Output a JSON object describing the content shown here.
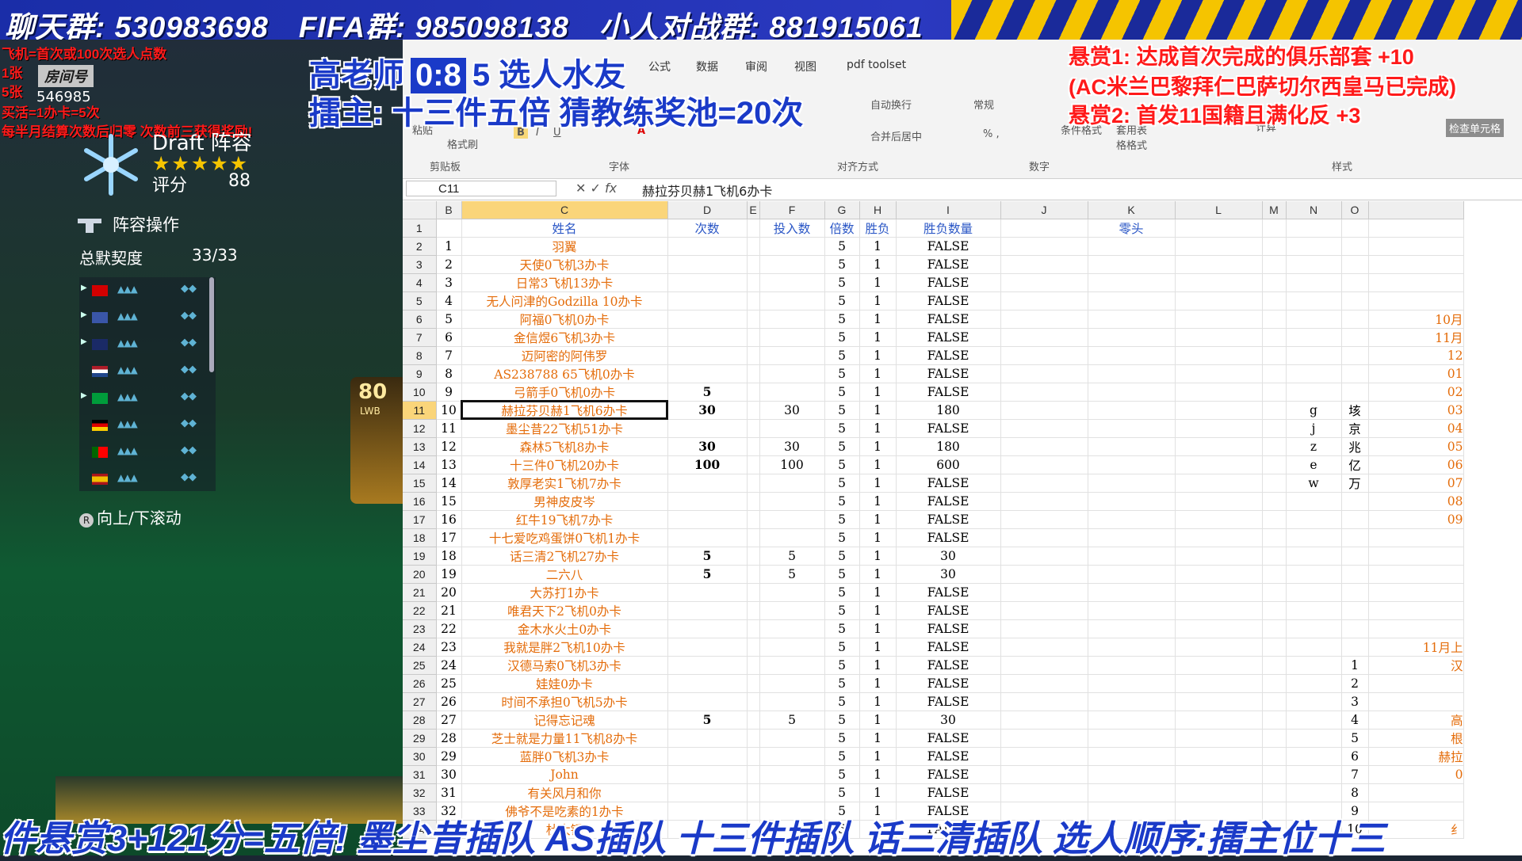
{
  "banner": {
    "chat_group": "聊天群: 530983698",
    "fifa_group": "FIFA群: 985098138",
    "battle_group": "小人对战群: 881915061"
  },
  "stream_notes": {
    "line1": "飞机=首次或100次选人点数",
    "line2": "1张",
    "line3": "5张",
    "line4": "买活=1办卡=5次",
    "line5": "每半月结算次数后归零 次数前三获得奖励!"
  },
  "room": {
    "label": "房间号",
    "number": "546985"
  },
  "draft": {
    "title": "Draft 阵容",
    "stars": "★★★★★",
    "rating_label": "评分",
    "rating_value": "88",
    "lineup_ops": "阵容操作",
    "chemistry_label": "总默契度",
    "chemistry_value": "33/33",
    "scroll_hint": "向上/下滚动",
    "player_rating": "80",
    "player_position": "LWB"
  },
  "overlay": {
    "teacher_prefix": "高老师",
    "score": "0:8",
    "teacher_suffix": "5 选人水友",
    "host_line": "擂主: 十三件五倍 猜教练奖池=20次",
    "reward1": "悬赏1: 达成首次完成的俱乐部套 +10",
    "reward1_note": "(AC米兰巴黎拜仁巴萨切尔西皇马已完成)",
    "reward2": "悬赏2: 首发11国籍且满化反 +3",
    "ticker": "件悬赏3+121分=五倍! 墨尘昔插队 AS插队 十三件插队 话三清插队 选人顺序:擂主位十三"
  },
  "excel": {
    "tabs": [
      "公式",
      "数据",
      "审阅",
      "视图",
      "pdf toolset"
    ],
    "groups": [
      "剪贴板",
      "字体",
      "对齐方式",
      "数字",
      "样式"
    ],
    "buttons": {
      "format_painter": "格式刷",
      "paste": "粘贴",
      "wrap_text": "自动换行",
      "merge_center": "合并后居中",
      "number_format": "常规",
      "conditional_format": "条件格式",
      "table_format": "套用表格格式",
      "calc": "计算",
      "check_cell": "检查单元格"
    },
    "name_box": "C11",
    "formula": "赫拉芬贝赫1飞机6办卡",
    "columns": [
      "B",
      "C",
      "D",
      "E",
      "F",
      "G",
      "H",
      "I",
      "J",
      "K",
      "L",
      "M",
      "N",
      "O",
      ""
    ],
    "header_row": {
      "c": "姓名",
      "d": "次数",
      "f": "投入数",
      "g": "倍数",
      "h": "胜负",
      "i": "胜负数量",
      "k": "零头"
    },
    "rows": [
      {
        "r": "2",
        "b": "1",
        "c": "羽翼",
        "d": "",
        "f": "",
        "g": "5",
        "h": "1",
        "i": "FALSE",
        "n": "",
        "o": "",
        "p": ""
      },
      {
        "r": "3",
        "b": "2",
        "c": "天使0飞机3办卡",
        "d": "",
        "f": "",
        "g": "5",
        "h": "1",
        "i": "FALSE",
        "n": "",
        "o": "",
        "p": ""
      },
      {
        "r": "4",
        "b": "3",
        "c": "日常3飞机13办卡",
        "d": "",
        "f": "",
        "g": "5",
        "h": "1",
        "i": "FALSE",
        "n": "",
        "o": "",
        "p": ""
      },
      {
        "r": "5",
        "b": "4",
        "c": "无人问津的Godzilla 10办卡",
        "d": "",
        "f": "",
        "g": "5",
        "h": "1",
        "i": "FALSE",
        "n": "",
        "o": "",
        "p": ""
      },
      {
        "r": "6",
        "b": "5",
        "c": "阿福0飞机0办卡",
        "d": "",
        "f": "",
        "g": "5",
        "h": "1",
        "i": "FALSE",
        "n": "",
        "o": "",
        "p": "10月"
      },
      {
        "r": "7",
        "b": "6",
        "c": "金信煜6飞机3办卡",
        "d": "",
        "f": "",
        "g": "5",
        "h": "1",
        "i": "FALSE",
        "n": "",
        "o": "",
        "p": "11月"
      },
      {
        "r": "8",
        "b": "7",
        "c": "迈阿密的阿伟罗",
        "d": "",
        "f": "",
        "g": "5",
        "h": "1",
        "i": "FALSE",
        "n": "",
        "o": "",
        "p": "12"
      },
      {
        "r": "9",
        "b": "8",
        "c": "AS238788 65飞机0办卡",
        "d": "",
        "f": "",
        "g": "5",
        "h": "1",
        "i": "FALSE",
        "n": "",
        "o": "",
        "p": "01"
      },
      {
        "r": "10",
        "b": "9",
        "c": "弓箭手0飞机0办卡",
        "d": "5",
        "f": "",
        "g": "5",
        "h": "1",
        "i": "FALSE",
        "n": "",
        "o": "",
        "p": "02"
      },
      {
        "r": "11",
        "b": "10",
        "c": "赫拉芬贝赫1飞机6办卡",
        "d": "30",
        "f": "30",
        "g": "5",
        "h": "1",
        "i": "180",
        "n": "g",
        "o": "垓",
        "p": "03"
      },
      {
        "r": "12",
        "b": "11",
        "c": "墨尘昔22飞机51办卡",
        "d": "",
        "f": "",
        "g": "5",
        "h": "1",
        "i": "FALSE",
        "n": "j",
        "o": "京",
        "p": "04"
      },
      {
        "r": "13",
        "b": "12",
        "c": "森林5飞机8办卡",
        "d": "30",
        "f": "30",
        "g": "5",
        "h": "1",
        "i": "180",
        "n": "z",
        "o": "兆",
        "p": "05"
      },
      {
        "r": "14",
        "b": "13",
        "c": "十三件0飞机20办卡",
        "d": "100",
        "f": "100",
        "g": "5",
        "h": "1",
        "i": "600",
        "n": "e",
        "o": "亿",
        "p": "06"
      },
      {
        "r": "15",
        "b": "14",
        "c": "敦厚老实1飞机7办卡",
        "d": "",
        "f": "",
        "g": "5",
        "h": "1",
        "i": "FALSE",
        "n": "w",
        "o": "万",
        "p": "07"
      },
      {
        "r": "16",
        "b": "15",
        "c": "男神皮皮岑",
        "d": "",
        "f": "",
        "g": "5",
        "h": "1",
        "i": "FALSE",
        "n": "",
        "o": "",
        "p": "08"
      },
      {
        "r": "17",
        "b": "16",
        "c": "红牛19飞机7办卡",
        "d": "",
        "f": "",
        "g": "5",
        "h": "1",
        "i": "FALSE",
        "n": "",
        "o": "",
        "p": "09"
      },
      {
        "r": "18",
        "b": "17",
        "c": "十七爱吃鸡蛋饼0飞机1办卡",
        "d": "",
        "f": "",
        "g": "5",
        "h": "1",
        "i": "FALSE",
        "n": "",
        "o": "",
        "p": ""
      },
      {
        "r": "19",
        "b": "18",
        "c": "话三清2飞机27办卡",
        "d": "5",
        "f": "5",
        "g": "5",
        "h": "1",
        "i": "30",
        "n": "",
        "o": "",
        "p": ""
      },
      {
        "r": "20",
        "b": "19",
        "c": "二六八",
        "d": "5",
        "f": "5",
        "g": "5",
        "h": "1",
        "i": "30",
        "n": "",
        "o": "",
        "p": ""
      },
      {
        "r": "21",
        "b": "20",
        "c": "大苏打1办卡",
        "d": "",
        "f": "",
        "g": "5",
        "h": "1",
        "i": "FALSE",
        "n": "",
        "o": "",
        "p": ""
      },
      {
        "r": "22",
        "b": "21",
        "c": "唯君天下2飞机0办卡",
        "d": "",
        "f": "",
        "g": "5",
        "h": "1",
        "i": "FALSE",
        "n": "",
        "o": "",
        "p": ""
      },
      {
        "r": "23",
        "b": "22",
        "c": "金木水火土0办卡",
        "d": "",
        "f": "",
        "g": "5",
        "h": "1",
        "i": "FALSE",
        "n": "",
        "o": "",
        "p": ""
      },
      {
        "r": "24",
        "b": "23",
        "c": "我就是胖2飞机10办卡",
        "d": "",
        "f": "",
        "g": "5",
        "h": "1",
        "i": "FALSE",
        "n": "",
        "o": "",
        "p": "11月上"
      },
      {
        "r": "25",
        "b": "24",
        "c": "汉德马索0飞机3办卡",
        "d": "",
        "f": "",
        "g": "5",
        "h": "1",
        "i": "FALSE",
        "n": "",
        "o": "1",
        "p": "汉"
      },
      {
        "r": "26",
        "b": "25",
        "c": "娃娃0办卡",
        "d": "",
        "f": "",
        "g": "5",
        "h": "1",
        "i": "FALSE",
        "n": "",
        "o": "2",
        "p": ""
      },
      {
        "r": "27",
        "b": "26",
        "c": "时间不承担0飞机5办卡",
        "d": "",
        "f": "",
        "g": "5",
        "h": "1",
        "i": "FALSE",
        "n": "",
        "o": "3",
        "p": ""
      },
      {
        "r": "28",
        "b": "27",
        "c": "记得忘记魂",
        "d": "5",
        "f": "5",
        "g": "5",
        "h": "1",
        "i": "30",
        "n": "",
        "o": "4",
        "p": "高"
      },
      {
        "r": "29",
        "b": "28",
        "c": "芝士就是力量11飞机8办卡",
        "d": "",
        "f": "",
        "g": "5",
        "h": "1",
        "i": "FALSE",
        "n": "",
        "o": "5",
        "p": "根"
      },
      {
        "r": "30",
        "b": "29",
        "c": "蓝胖0飞机3办卡",
        "d": "",
        "f": "",
        "g": "5",
        "h": "1",
        "i": "FALSE",
        "n": "",
        "o": "6",
        "p": "赫拉"
      },
      {
        "r": "31",
        "b": "30",
        "c": "John",
        "d": "",
        "f": "",
        "g": "5",
        "h": "1",
        "i": "FALSE",
        "n": "",
        "o": "7",
        "p": "0"
      },
      {
        "r": "32",
        "b": "31",
        "c": "有关风月和你",
        "d": "",
        "f": "",
        "g": "5",
        "h": "1",
        "i": "FALSE",
        "n": "",
        "o": "8",
        "p": ""
      },
      {
        "r": "33",
        "b": "32",
        "c": "佛爷不是吃素的1办卡",
        "d": "",
        "f": "",
        "g": "5",
        "h": "1",
        "i": "FALSE",
        "n": "",
        "o": "9",
        "p": ""
      },
      {
        "r": "34",
        "b": "33",
        "c": "杜大锤",
        "d": "",
        "f": "",
        "g": "5",
        "h": "1",
        "i": "FALSE",
        "n": "",
        "o": "10",
        "p": "纟"
      }
    ],
    "colors": {
      "header": "#2b57c6",
      "name": "#e46c0a",
      "selected_header": "#fad57a"
    }
  }
}
